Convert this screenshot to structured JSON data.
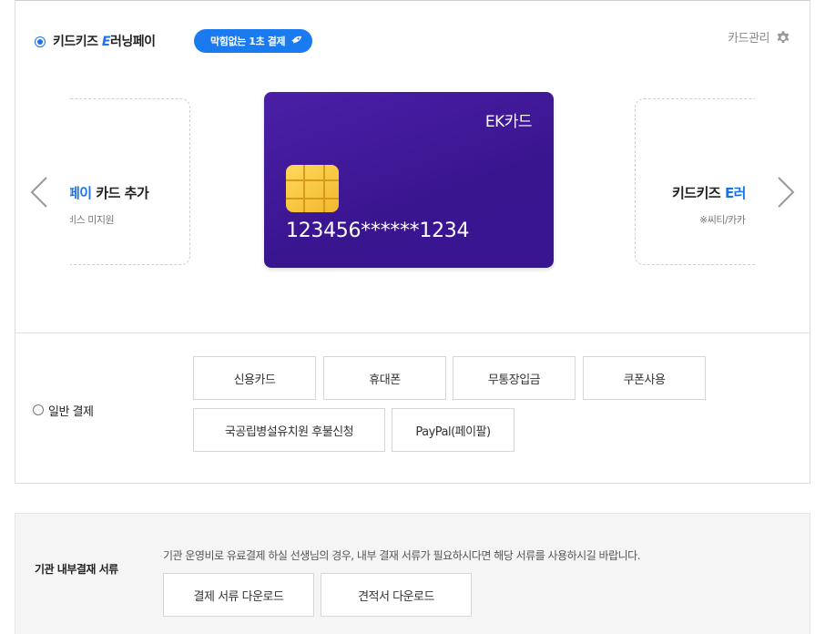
{
  "easy_pay": {
    "title_prefix": "키드키즈 ",
    "title_mark": "E",
    "title_suffix": "러닝페이",
    "badge": "막힘없는 1초 결제",
    "card_manage": "카드관리"
  },
  "carousel": {
    "left_slide": {
      "dash": "-",
      "title_hl": "페이",
      "title_rest": " 카드 추가",
      "sub": "비스 미지원"
    },
    "card": {
      "name": "EK카드",
      "number": "123456******1234"
    },
    "right_slide": {
      "dash": "-",
      "title_prefix": "키드키즈 ",
      "title_hl": "E러",
      "sub": "※씨티/카카"
    }
  },
  "general_pay": {
    "label": "일반 결제",
    "methods": [
      "신용카드",
      "휴대폰",
      "무통장입금",
      "쿠폰사용",
      "국공립병설유치원 후불신청",
      "PayPal(페이팔)"
    ]
  },
  "documents": {
    "label": "기관 내부결재 서류",
    "description": "기관 운영비로 유료결제 하실 선생님의 경우, 내부 결재 서류가 필요하시다면 해당 서류를 사용하시길 바랍니다.",
    "buttons": [
      "결제 서류 다운로드",
      "견적서 다운로드"
    ]
  },
  "colors": {
    "accent": "#1a73e8",
    "card": "#3a1590",
    "chip": "#f2b82d"
  }
}
